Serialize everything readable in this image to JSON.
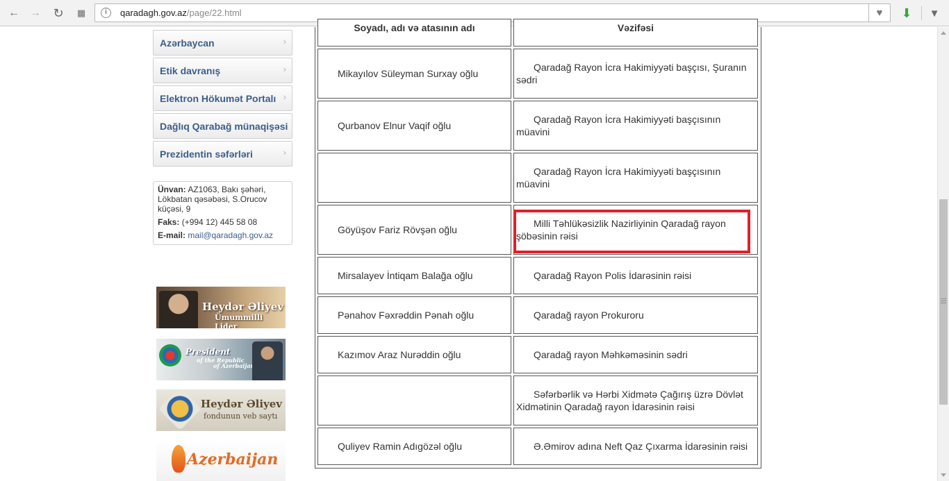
{
  "browser": {
    "url_host": "qaradagh.gov.az",
    "url_path": "/page/22.html"
  },
  "sidebar": {
    "menu": [
      {
        "label": "Azərbaycan"
      },
      {
        "label": "Etik davranış"
      },
      {
        "label": "Elektron Hökumət Portalı"
      },
      {
        "label": "Dağlıq Qarabağ münaqişəsi"
      },
      {
        "label": "Prezidentin səfərləri"
      }
    ],
    "contact": {
      "address_label": "Ünvan:",
      "address_value": "AZ1063, Bakı şəhəri, Lökbatan qəsəbəsi, S.Orucov küçəsi, 9",
      "fax_label": "Faks:",
      "fax_value": "(+994 12) 445 58 08",
      "email_label": "E-mail:",
      "email_value": "mail@qaradagh.gov.az"
    },
    "banners": [
      {
        "line1": "Heydər Əliyev",
        "line2": "Ümummilli Lider"
      },
      {
        "line1": "President",
        "line2": "of the Republic",
        "line3": "of Azerbaijan"
      },
      {
        "line1": "Heydər Əliyev",
        "line2": "fondunun veb saytı"
      },
      {
        "line1": "Azerbaijan"
      }
    ]
  },
  "table": {
    "headers": {
      "name": "Soyadı, adı və atasının adı",
      "position": "Vəzifəsi"
    },
    "rows": [
      {
        "name": "Mikayılov Süleyman Surxay oğlu",
        "position": "Qaradağ Rayon İcra Hakimiyyəti başçısı, Şuranın sədri"
      },
      {
        "name": "Qurbanov Elnur Vaqif oğlu",
        "position": "Qaradağ Rayon İcra Hakimiyyəti başçısının müavini"
      },
      {
        "name": "",
        "position": "Qaradağ Rayon İcra Hakimiyyəti başçısının müavini"
      },
      {
        "name": "Göyüşov Fariz Rövşən oğlu",
        "position": "Milli Təhlükəsizlik Nazirliyinin Qaradağ rayon şöbəsinin rəisi"
      },
      {
        "name": "Mirsalayev İntiqam Balağa oğlu",
        "position": "Qaradağ Rayon Polis İdarəsinin rəisi"
      },
      {
        "name": "Pənahov Fəxrəddin Pənah oğlu",
        "position": "Qaradağ rayon Prokuroru"
      },
      {
        "name": "Kazımov Araz Nurəddin oğlu",
        "position": "Qaradağ rayon Məhkəməsinin sədri"
      },
      {
        "name": "",
        "position": "Səfərbərlik və Hərbi Xidmətə Çağırış üzrə Dövlət Xidmətinin Qaradağ rayon İdarəsinin rəisi"
      },
      {
        "name": "Quliyev Ramin Adıgözəl oğlu",
        "position": "Ə.Əmirov adına Neft Qaz Çıxarma İdarəsinin rəisi"
      }
    ]
  },
  "colors": {
    "highlight": "#e0202a",
    "menu_text": "#3c5e8a"
  }
}
